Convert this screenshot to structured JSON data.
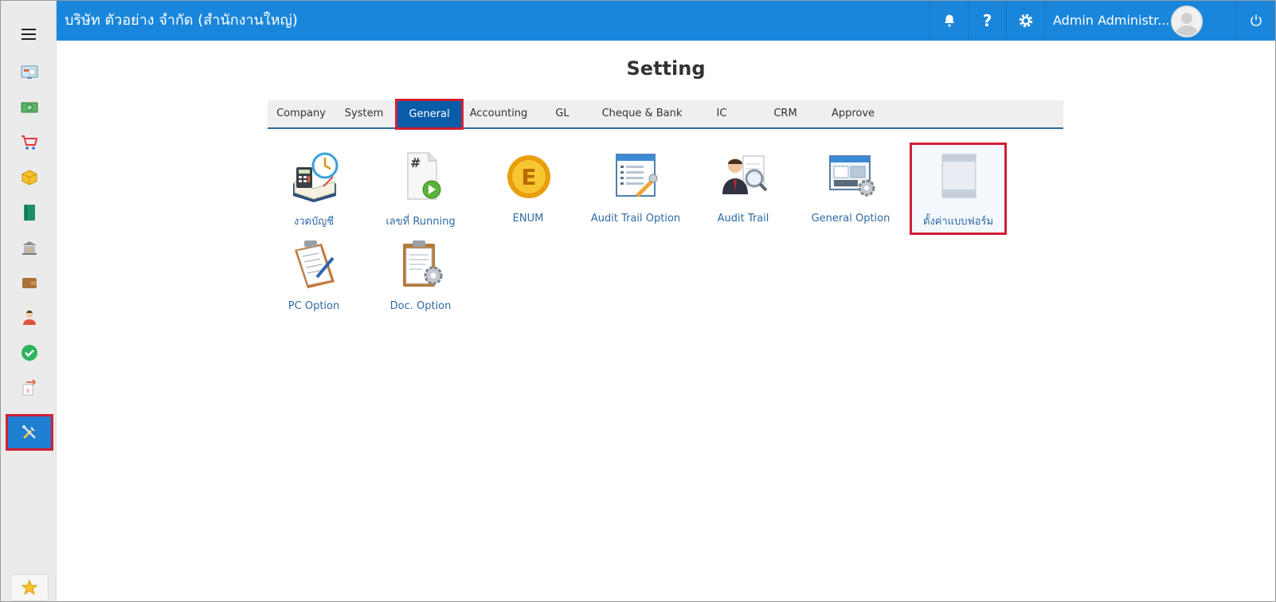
{
  "header": {
    "company_name": "บริษัท ตัวอย่าง จำกัด (สำนักงานใหญ่)",
    "user_name": "Admin Administr...",
    "accent": "#1a86db",
    "highlight": "#d11f34"
  },
  "sidebar": {
    "items": [
      {
        "icon": "dashboard-icon"
      },
      {
        "icon": "money-icon"
      },
      {
        "icon": "cart-icon"
      },
      {
        "icon": "box-icon"
      },
      {
        "icon": "book-icon"
      },
      {
        "icon": "bank-icon"
      },
      {
        "icon": "wallet-icon"
      },
      {
        "icon": "person-icon"
      },
      {
        "icon": "check-icon"
      },
      {
        "icon": "transfer-icon"
      },
      {
        "icon": "tools-icon",
        "active": true
      }
    ],
    "favorite_icon": "star-icon"
  },
  "page": {
    "title": "Setting"
  },
  "tabs": [
    {
      "label": "Company"
    },
    {
      "label": "System"
    },
    {
      "label": "General",
      "active": true
    },
    {
      "label": "Accounting"
    },
    {
      "label": "GL"
    },
    {
      "label": "Cheque & Bank"
    },
    {
      "label": "IC"
    },
    {
      "label": "CRM"
    },
    {
      "label": "Approve"
    }
  ],
  "tiles": [
    {
      "label": "งวดบัญชี",
      "icon": "calendar-calculator-icon"
    },
    {
      "label": "เลขที่ Running",
      "icon": "running-number-icon"
    },
    {
      "label": "ENUM",
      "icon": "enum-coin-icon"
    },
    {
      "label": "Audit Trail Option",
      "icon": "audit-trail-option-icon"
    },
    {
      "label": "Audit Trail",
      "icon": "audit-trail-icon"
    },
    {
      "label": "General Option",
      "icon": "general-option-icon"
    },
    {
      "label": "ตั้งค่าแบบฟอร์ม",
      "icon": "form-setting-icon",
      "selected": true
    },
    {
      "label": "PC Option",
      "icon": "pc-option-icon"
    },
    {
      "label": "Doc. Option",
      "icon": "doc-option-icon"
    }
  ]
}
